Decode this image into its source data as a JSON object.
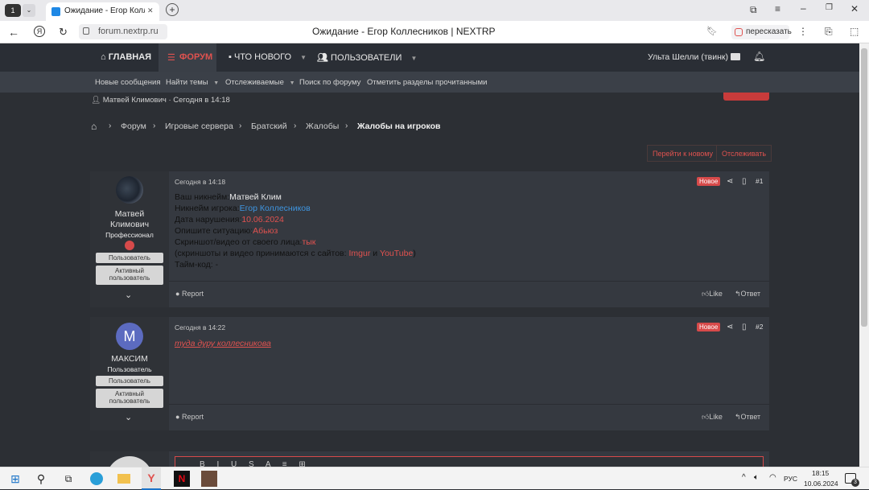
{
  "browser": {
    "tab_count": "1",
    "tab_title": "Ожидание - Егор Колл",
    "tab_close": "✕",
    "new_tab": "+",
    "url": "forum.nextrp.ru",
    "page_title": "Ожидание - Егор Коллесников | NEXTRP",
    "translate_label": "пересказать",
    "yandex_glyph": "Я"
  },
  "nav": {
    "home": "ГЛАВНАЯ",
    "forums": "ФОРУМ",
    "whats_new": "ЧТО НОВОГО",
    "members": "ПОЛЬЗОВАТЕЛИ",
    "account": "Ульта Шелли (твинк)"
  },
  "subnav": {
    "items": [
      "Новые сообщения",
      "Найти темы",
      "Отслеживаемые",
      "Поиск по форуму",
      "Отметить разделы прочитанными"
    ]
  },
  "thread_meta": "Матвей Климович · Сегодня в 14:18",
  "breadcrumbs": [
    "Форум",
    "Игровые сервера",
    "Братский",
    "Жалобы",
    "Жалобы на игроков"
  ],
  "thread_buttons": {
    "go_new": "Перейти к новому",
    "watch": "Отслеживать"
  },
  "posts": [
    {
      "user": {
        "name_line1": "Матвей",
        "name_line2": "Климович",
        "title": "Профессионал",
        "badge1": "Пользователь",
        "badge2_line1": "Активный",
        "badge2_line2": "пользователь"
      },
      "date": "Сегодня в 14:18",
      "new_label": "Новое",
      "number": "#1",
      "lines": {
        "l1_label": "Ваш никнейм:",
        "l1_value": "Матвей Клим",
        "l2_label": "Никнейм игрока:",
        "l2_value": "Егор Коллесников",
        "l3_label": "Дата нарушения:",
        "l3_value": "10.06.2024",
        "l4_label": "Опишите ситуацию:",
        "l4_value": "Абьюз",
        "l5_label": "Скриншот/видео от своего лица:",
        "l5_value": "тык",
        "l6_pre": "(скриншоты и видео принимаются с сайтов:",
        "l6_imgur": "Imgur",
        "l6_and": "и",
        "l6_yt": "YouTube",
        "l6_post": ")",
        "l7": "Тайм-код: -"
      },
      "report": "Report",
      "like": "Like",
      "reply": "Ответ"
    },
    {
      "user": {
        "avatar_letter": "M",
        "name": "МАКСИМ",
        "title": "Пользователь",
        "badge1": "Пользователь",
        "badge2_line1": "Активный",
        "badge2_line2": "пользователь"
      },
      "date": "Сегодня в 14:22",
      "new_label": "Новое",
      "number": "#2",
      "text": "туда дуру коллесникова",
      "report": "Report",
      "like": "Like",
      "reply": "Ответ"
    }
  ],
  "taskbar": {
    "lang": "РУС",
    "time": "18:15",
    "date": "10.06.2024",
    "notif_count": "3"
  },
  "colors": {
    "accent_red": "#e0524f",
    "link_blue": "#3e95e0",
    "nav_bg": "#2a2e35"
  }
}
